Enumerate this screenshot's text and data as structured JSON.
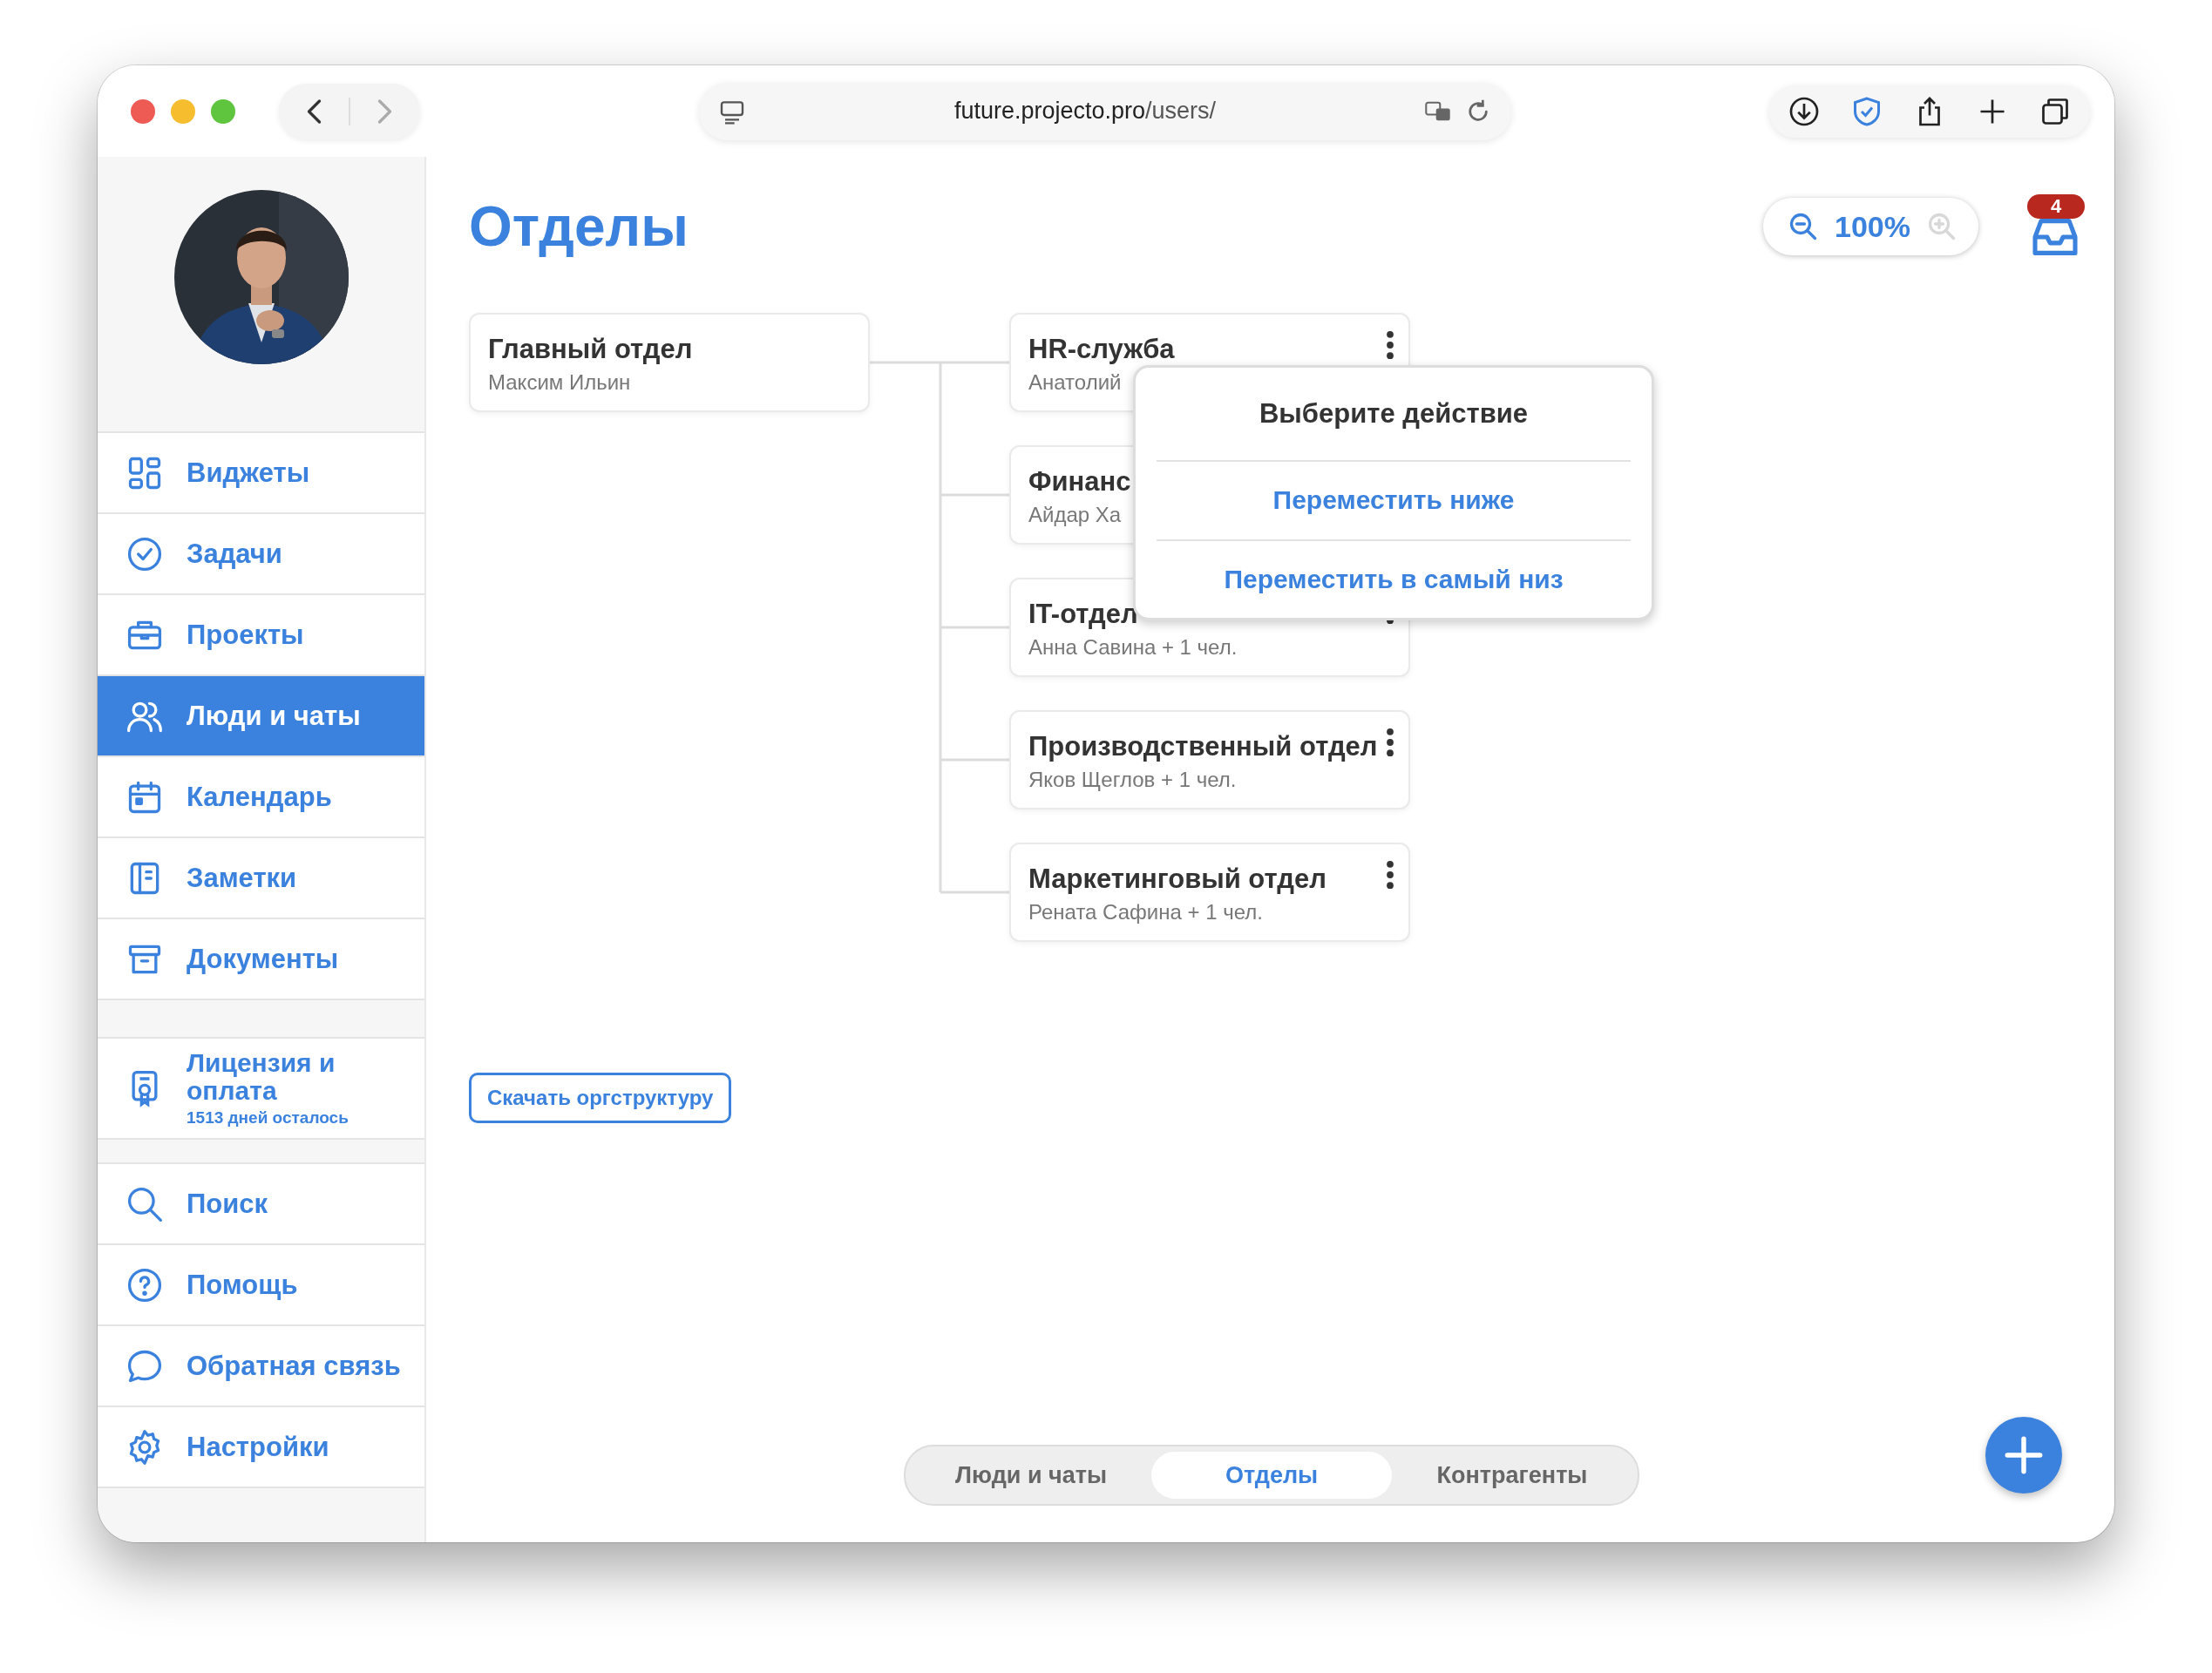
{
  "browser": {
    "url_host": "future.projecto.pro",
    "url_path": "/users/"
  },
  "sidebar": {
    "nav": [
      {
        "label": "Виджеты",
        "selected": false
      },
      {
        "label": "Задачи",
        "selected": false
      },
      {
        "label": "Проекты",
        "selected": false
      },
      {
        "label": "Люди и чаты",
        "selected": true
      },
      {
        "label": "Календарь",
        "selected": false
      },
      {
        "label": "Заметки",
        "selected": false
      },
      {
        "label": "Документы",
        "selected": false
      }
    ],
    "license": {
      "title": "Лицензия и оплата",
      "subtitle": "1513 дней осталось"
    },
    "bottom_nav": [
      {
        "label": "Поиск"
      },
      {
        "label": "Помощь"
      },
      {
        "label": "Обратная связь"
      },
      {
        "label": "Настройки"
      }
    ]
  },
  "page": {
    "title": "Отделы",
    "zoom": "100%",
    "notifications": "4"
  },
  "org_chart": {
    "root": {
      "name": "Главный отдел",
      "head": "Максим Ильин"
    },
    "children": [
      {
        "name": "HR-служба",
        "head": "Анатолий",
        "menu_button": true
      },
      {
        "name": "Финанс",
        "head": "Айдар Ха",
        "menu_button": false
      },
      {
        "name": "IT-отдел",
        "head": "Анна Савина + 1 чел.",
        "menu_button": true
      },
      {
        "name": "Производственный отдел",
        "head": "Яков Щеглов + 1 чел.",
        "menu_button": true
      },
      {
        "name": "Маркетинговый отдел",
        "head": "Рената Сафина + 1 чел.",
        "menu_button": true
      }
    ]
  },
  "action_menu": {
    "title": "Выберите действие",
    "actions": [
      "Переместить ниже",
      "Переместить в самый низ"
    ]
  },
  "download_button": "Скачать оргструктуру",
  "tabs": [
    {
      "label": "Люди и чаты",
      "selected": false
    },
    {
      "label": "Отделы",
      "selected": true
    },
    {
      "label": "Контрагенты",
      "selected": false
    }
  ]
}
